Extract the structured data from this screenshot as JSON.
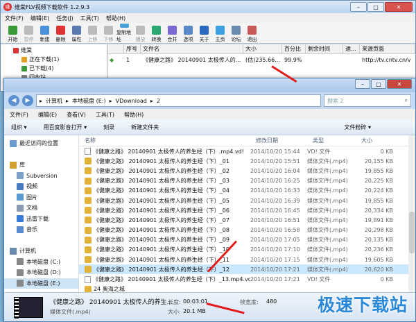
{
  "back": {
    "title": "维棠FLV视频下载软件 1.2.9.3",
    "menu": [
      "文件(F)",
      "编辑(E)",
      "任务(J)",
      "工具(T)",
      "帮助(H)"
    ],
    "tools": [
      {
        "label": "开始",
        "color": "#3a9a3a"
      },
      {
        "label": "暂停",
        "color": "#bbb",
        "dis": true
      },
      {
        "label": "新建",
        "color": "#4a90d9"
      },
      {
        "label": "删除",
        "color": "#d33"
      },
      {
        "label": "属性",
        "color": "#5a7ab0"
      },
      {
        "label": "上移",
        "color": "#bbb",
        "dis": true
      },
      {
        "label": "下移",
        "color": "#bbb",
        "dis": true
      },
      {
        "label": "复制地址",
        "color": "#4aa0d8"
      },
      {
        "label": "播放",
        "color": "#bbb",
        "dis": true
      },
      {
        "label": "转换",
        "color": "#2aa870"
      },
      {
        "label": "合并",
        "color": "#7a6ad0"
      },
      {
        "label": "选项",
        "color": "#5a88c8"
      },
      {
        "label": "关于",
        "color": "#2a6ac0"
      },
      {
        "label": "主页",
        "color": "#3aa0e0"
      },
      {
        "label": "论坛",
        "color": "#6a8ab0"
      },
      {
        "label": "退出",
        "color": "#c85a5a"
      }
    ],
    "tree": [
      {
        "label": "维棠",
        "color": "#d33"
      },
      {
        "label": "正在下载(1)",
        "color": "#e0a020"
      },
      {
        "label": "已下载(4)",
        "color": "#3a9a3a"
      },
      {
        "label": "回收站",
        "color": "#888"
      }
    ],
    "headers": [
      "序号",
      "文件名",
      "大小",
      "百分比",
      "剩余时间",
      "速...",
      "来源页面"
    ],
    "row": {
      "no": "1",
      "name": "《健康之路》 20140901 太极传人的...",
      "size": "(估)235.66...",
      "pct": "99.9%",
      "remain": "",
      "speed": "",
      "src": "http://tv.cntv.cn/v"
    }
  },
  "front": {
    "breadcrumb": [
      "计算机",
      "本地磁盘 (E:)",
      "VDownload",
      "2"
    ],
    "search_placeholder": "搜索 2",
    "menu": [
      "文件(F)",
      "编辑(E)",
      "查看(V)",
      "工具(T)",
      "帮助(H)"
    ],
    "commands": [
      "组织 ▾",
      "用百度影音打开 ▾",
      "刻录",
      "新建文件夹"
    ],
    "view_label": "文件粉碎 ▾",
    "nav": [
      {
        "label": "最近访问的位置",
        "c": "#6a9ad0",
        "indent": false
      },
      {
        "label": "",
        "c": "",
        "indent": false
      },
      {
        "label": "库",
        "c": "#d0a030",
        "indent": false
      },
      {
        "label": "Subversion",
        "c": "#7aa0c8",
        "indent": true
      },
      {
        "label": "视频",
        "c": "#4a7ac0",
        "indent": true
      },
      {
        "label": "图片",
        "c": "#5a9ad0",
        "indent": true
      },
      {
        "label": "文档",
        "c": "#8a9ab0",
        "indent": true
      },
      {
        "label": "迅雷下载",
        "c": "#3a7ad8",
        "indent": true
      },
      {
        "label": "音乐",
        "c": "#5a8ad0",
        "indent": true
      },
      {
        "label": "",
        "c": "",
        "indent": false
      },
      {
        "label": "计算机",
        "c": "#6a8ab0",
        "indent": false
      },
      {
        "label": "本地磁盘 (C:)",
        "c": "#888",
        "indent": true
      },
      {
        "label": "本地磁盘 (D:)",
        "c": "#888",
        "indent": true
      },
      {
        "label": "本地磁盘 (E:)",
        "c": "#888",
        "indent": true,
        "sel": true
      }
    ],
    "headers": {
      "name": "名称",
      "date": "修改日期",
      "type": "类型",
      "size": "大小"
    },
    "files": [
      {
        "name": "《健康之路》 20140901 太极传人的养生经（下）.mp4.vd!",
        "date": "2014/10/20 15:44",
        "type": "VD! 文件",
        "size": "0 KB",
        "vd": true
      },
      {
        "name": "《健康之路》 20140901 太极传人的养生经（下）_01",
        "date": "2014/10/20 15:51",
        "type": "媒体文件(.mp4)",
        "size": "20,155 KB"
      },
      {
        "name": "《健康之路》 20140901 太极传人的养生经（下）_02",
        "date": "2014/10/20 16:04",
        "type": "媒体文件(.mp4)",
        "size": "19,855 KB"
      },
      {
        "name": "《健康之路》 20140901 太极传人的养生经（下）_03",
        "date": "2014/10/20 16:25",
        "type": "媒体文件(.mp4)",
        "size": "20,225 KB"
      },
      {
        "name": "《健康之路》 20140901 太极传人的养生经（下）_04",
        "date": "2014/10/20 16:33",
        "type": "媒体文件(.mp4)",
        "size": "20,224 KB"
      },
      {
        "name": "《健康之路》 20140901 太极传人的养生经（下）_05",
        "date": "2014/10/20 16:39",
        "type": "媒体文件(.mp4)",
        "size": "19,855 KB"
      },
      {
        "name": "《健康之路》 20140901 太极传人的养生经（下）_06",
        "date": "2014/10/20 16:45",
        "type": "媒体文件(.mp4)",
        "size": "20,334 KB"
      },
      {
        "name": "《健康之路》 20140901 太极传人的养生经（下）_07",
        "date": "2014/10/20 16:51",
        "type": "媒体文件(.mp4)",
        "size": "19,891 KB"
      },
      {
        "name": "《健康之路》 20140901 太极传人的养生经（下）_08",
        "date": "2014/10/20 16:58",
        "type": "媒体文件(.mp4)",
        "size": "20,298 KB"
      },
      {
        "name": "《健康之路》 20140901 太极传人的养生经（下）_09",
        "date": "2014/10/20 17:05",
        "type": "媒体文件(.mp4)",
        "size": "20,135 KB"
      },
      {
        "name": "《健康之路》 20140901 太极传人的养生经（下）_10",
        "date": "2014/10/20 17:10",
        "type": "媒体文件(.mp4)",
        "size": "20,236 KB"
      },
      {
        "name": "《健康之路》 20140901 太极传人的养生经（下）_11",
        "date": "2014/10/20 17:15",
        "type": "媒体文件(.mp4)",
        "size": "19,605 KB"
      },
      {
        "name": "《健康之路》 20140901 太极传人的养生经（下）_12",
        "date": "2014/10/20 17:21",
        "type": "媒体文件(.mp4)",
        "size": "20,620 KB",
        "sel": true
      },
      {
        "name": "《健康之路》 20140901 太极传人的养生经（下）_13.mp4.vd!",
        "date": "2014/10/20 17:21",
        "type": "VD! 文件",
        "size": "0 KB",
        "vd": true
      },
      {
        "name": "24 奥海之城",
        "date": "",
        "type": "",
        "size": "",
        "folder": true
      }
    ],
    "status": {
      "name": "《健康之路》 20140901 太极传人的养生...",
      "type": "媒体文件(.mp4)",
      "length_label": "长度:",
      "length": "00:03:01",
      "size_label": "大小:",
      "size": "20.1 MB",
      "width_label": "帧宽度:",
      "width": "480"
    }
  },
  "watermark": "极速下载站"
}
